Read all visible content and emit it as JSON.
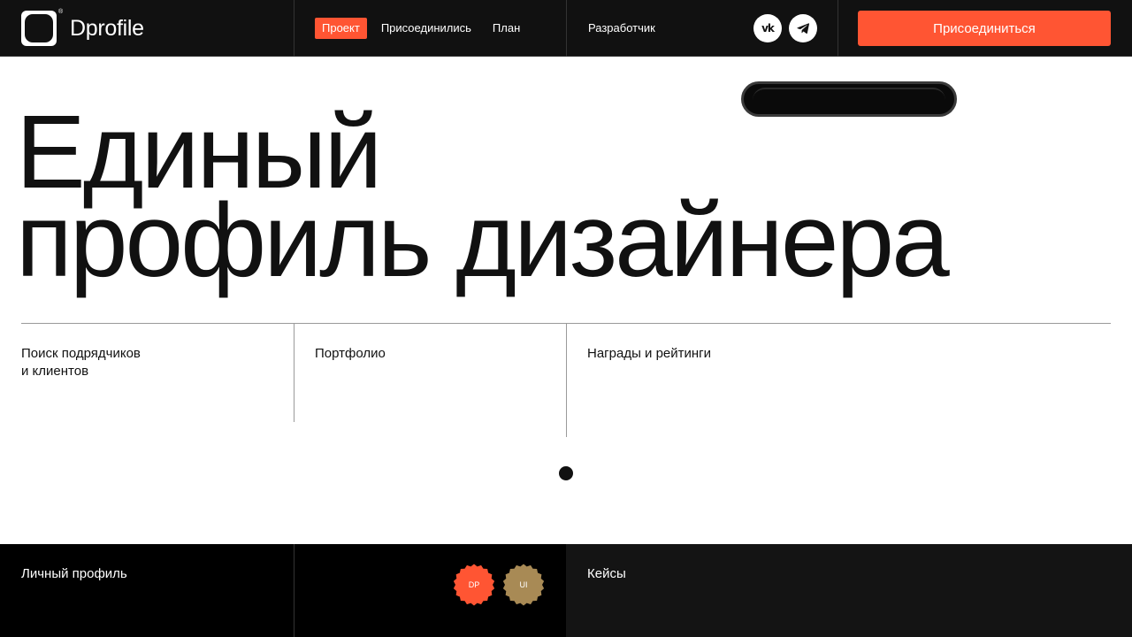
{
  "header": {
    "logo_text": "Dprofile",
    "logo_reg": "®",
    "nav": [
      {
        "label": "Проект",
        "active": true
      },
      {
        "label": "Присоединились",
        "active": false
      },
      {
        "label": "План",
        "active": false
      }
    ],
    "developer": "Разработчик",
    "social": [
      {
        "icon": "vk-icon",
        "glyph": "vk"
      },
      {
        "icon": "telegram-icon"
      }
    ],
    "join_button": "Присоединиться"
  },
  "hero": {
    "title_line1": "Единый",
    "title_line2": "профиль дизайнера"
  },
  "features": [
    {
      "line1": "Поиск подрядчиков",
      "line2": "и клиентов"
    },
    {
      "line1": "Портфолио"
    },
    {
      "line1": "Награды и рейтинги"
    }
  ],
  "bottom": {
    "left_label": "Личный профиль",
    "badges": [
      {
        "text": "DP",
        "color": "#ff5533"
      },
      {
        "text": "UI",
        "color": "#a88a55"
      }
    ],
    "right_label": "Кейсы"
  },
  "colors": {
    "accent": "#ff5533",
    "dark": "#111111",
    "badge_gold": "#a88a55"
  }
}
